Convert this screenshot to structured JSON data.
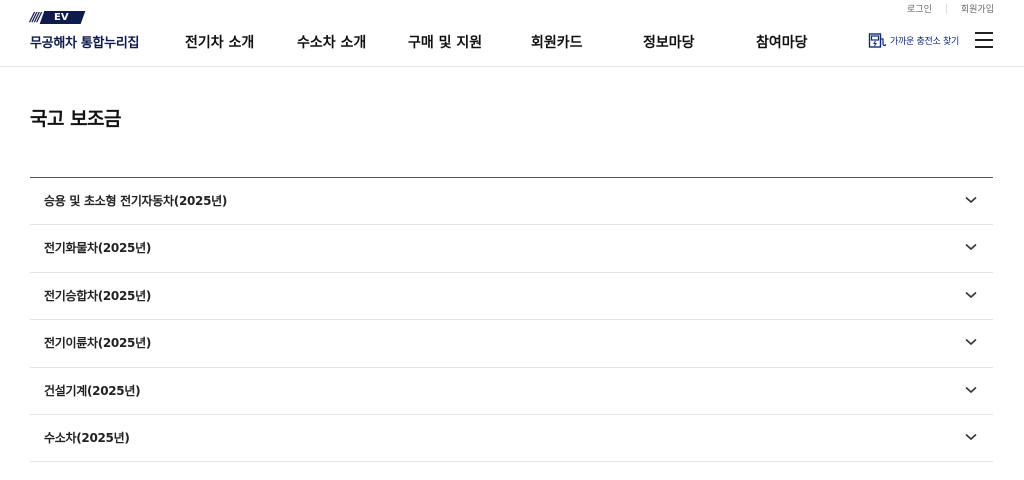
{
  "header": {
    "logo": {
      "badge": "EV",
      "site_name": "무공해차 통합누리집"
    },
    "nav": [
      {
        "label": "전기차 소개"
      },
      {
        "label": "수소차 소개"
      },
      {
        "label": "구매 및 지원"
      },
      {
        "label": "회원카드"
      },
      {
        "label": "정보마당"
      },
      {
        "label": "참여마당"
      }
    ],
    "util": {
      "login": "로그인",
      "signup": "회원가입"
    },
    "charger_search": {
      "label": "가까운 충전소 찾기",
      "icon": "charger-search-icon"
    },
    "menu_icon": "hamburger-menu-icon"
  },
  "page": {
    "title": "국고 보조금"
  },
  "accordion": {
    "items": [
      {
        "label": "승용 및 초소형 전기자동차(2025년)"
      },
      {
        "label": "전기화물차(2025년)"
      },
      {
        "label": "전기승합차(2025년)"
      },
      {
        "label": "전기이륜차(2025년)"
      },
      {
        "label": "건설기계(2025년)"
      },
      {
        "label": "수소차(2025년)"
      }
    ],
    "chevron_icon": "chevron-down-icon"
  },
  "colors": {
    "brand": "#0f1b4c",
    "link": "#0f2a7a",
    "divider": "#e4e4e4",
    "top_rule": "#555555"
  }
}
